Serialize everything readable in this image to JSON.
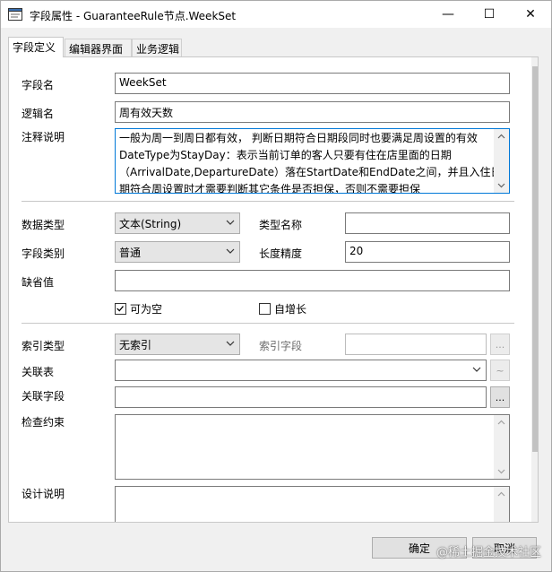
{
  "window": {
    "title": "字段属性 - GuaranteeRule节点.WeekSet",
    "minimize_glyph": "—",
    "maximize_glyph": "☐",
    "close_glyph": "✕"
  },
  "tabs": [
    {
      "label": "字段定义",
      "active": true
    },
    {
      "label": "编辑器界面",
      "active": false
    },
    {
      "label": "业务逻辑",
      "active": false
    }
  ],
  "form": {
    "field_name_label": "字段名",
    "field_name_value": "WeekSet",
    "logic_name_label": "逻辑名",
    "logic_name_value": "周有效天数",
    "comment_label": "注释说明",
    "comment_lines": [
      "一般为周一到周日都有效，  判断日期符合日期段同时也要满足周设置的有效",
      "DateType为StayDay：表示当前订单的客人只要有住在店里面的日期",
      "（ArrivalDate,DepartureDate）落在StartDate和EndDate之间，并且入住日",
      "期符合周设置时才需要判断其它条件是否担保，否则不需要担保"
    ],
    "data_type_label": "数据类型",
    "data_type_value": "文本(String)",
    "type_name_label": "类型名称",
    "type_name_value": "",
    "field_category_label": "字段类别",
    "field_category_value": "普通",
    "length_label": "长度精度",
    "length_value": "20",
    "default_label": "缺省值",
    "default_value": "",
    "nullable_label": "可为空",
    "nullable_checked": true,
    "autoinc_label": "自增长",
    "autoinc_checked": false,
    "index_type_label": "索引类型",
    "index_type_value": "无索引",
    "index_field_label": "索引字段",
    "index_field_value": "",
    "index_field_btn": "...",
    "related_table_label": "关联表",
    "related_table_value": "",
    "related_table_btn": "~",
    "related_field_label": "关联字段",
    "related_field_value": "",
    "related_field_btn": "...",
    "check_label": "检查约束",
    "design_label": "设计说明"
  },
  "footer": {
    "ok_label": "确定",
    "cancel_label": "取消"
  },
  "watermark": "@稀土掘金技术社区",
  "colors": {
    "focus_border": "#0078d7",
    "window_bg": "#f0f0f0",
    "combo_bg": "#e5e5e5"
  }
}
